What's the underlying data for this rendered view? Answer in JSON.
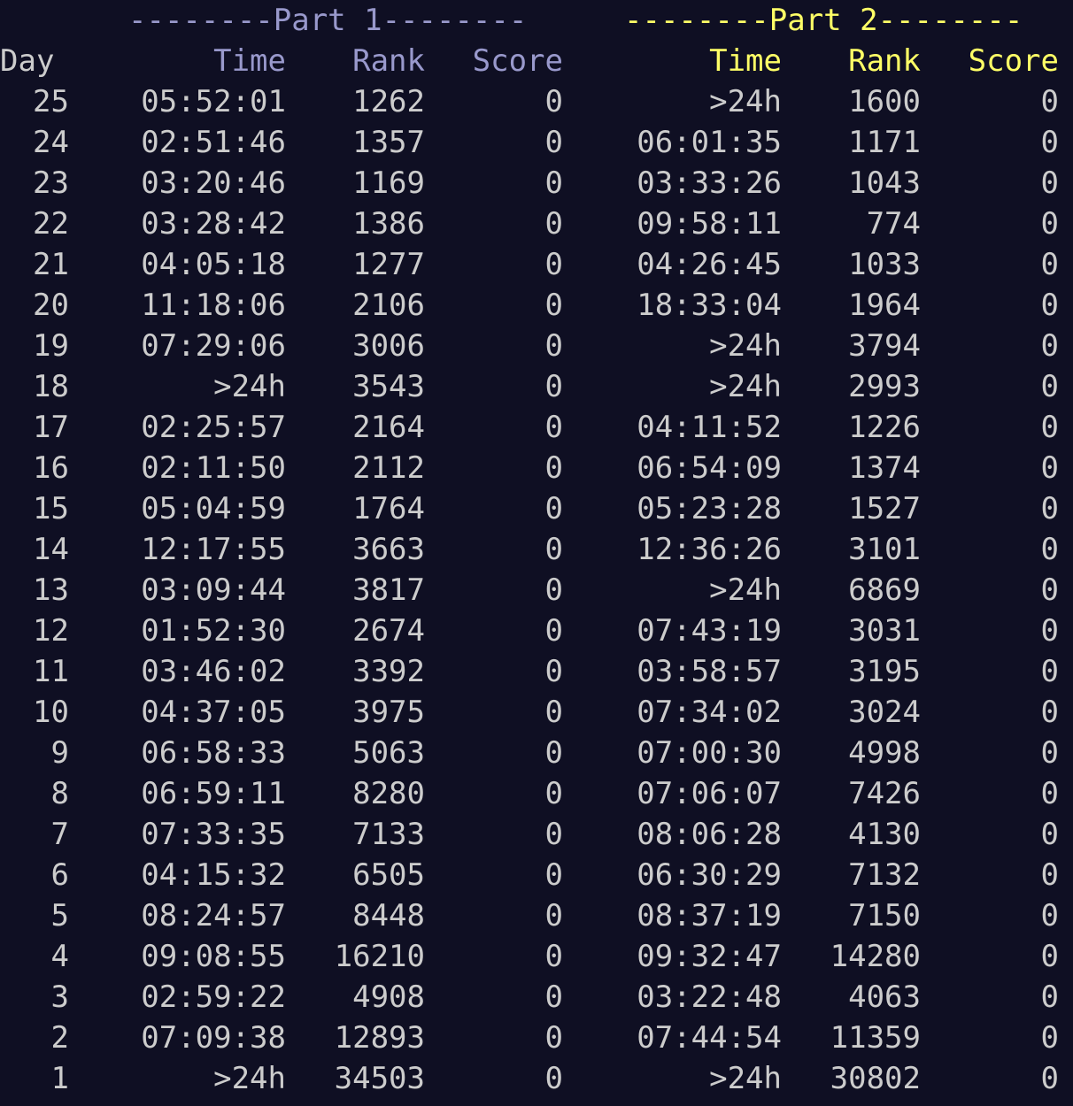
{
  "colors": {
    "background": "#0f0f23",
    "text": "#cccccc",
    "part1": "#9999cc",
    "part2": "#ffff66"
  },
  "banner": {
    "part1": "--------Part 1--------",
    "part2": "--------Part 2--------"
  },
  "headers": {
    "day": "Day",
    "part1": {
      "time": "Time",
      "rank": "Rank",
      "score": "Score"
    },
    "part2": {
      "time": "Time",
      "rank": "Rank",
      "score": "Score"
    }
  },
  "rows": [
    {
      "day": "25",
      "t1": "05:52:01",
      "r1": "1262",
      "s1": "0",
      "t2": ">24h",
      "r2": "1600",
      "s2": "0"
    },
    {
      "day": "24",
      "t1": "02:51:46",
      "r1": "1357",
      "s1": "0",
      "t2": "06:01:35",
      "r2": "1171",
      "s2": "0"
    },
    {
      "day": "23",
      "t1": "03:20:46",
      "r1": "1169",
      "s1": "0",
      "t2": "03:33:26",
      "r2": "1043",
      "s2": "0"
    },
    {
      "day": "22",
      "t1": "03:28:42",
      "r1": "1386",
      "s1": "0",
      "t2": "09:58:11",
      "r2": "774",
      "s2": "0"
    },
    {
      "day": "21",
      "t1": "04:05:18",
      "r1": "1277",
      "s1": "0",
      "t2": "04:26:45",
      "r2": "1033",
      "s2": "0"
    },
    {
      "day": "20",
      "t1": "11:18:06",
      "r1": "2106",
      "s1": "0",
      "t2": "18:33:04",
      "r2": "1964",
      "s2": "0"
    },
    {
      "day": "19",
      "t1": "07:29:06",
      "r1": "3006",
      "s1": "0",
      "t2": ">24h",
      "r2": "3794",
      "s2": "0"
    },
    {
      "day": "18",
      "t1": ">24h",
      "r1": "3543",
      "s1": "0",
      "t2": ">24h",
      "r2": "2993",
      "s2": "0"
    },
    {
      "day": "17",
      "t1": "02:25:57",
      "r1": "2164",
      "s1": "0",
      "t2": "04:11:52",
      "r2": "1226",
      "s2": "0"
    },
    {
      "day": "16",
      "t1": "02:11:50",
      "r1": "2112",
      "s1": "0",
      "t2": "06:54:09",
      "r2": "1374",
      "s2": "0"
    },
    {
      "day": "15",
      "t1": "05:04:59",
      "r1": "1764",
      "s1": "0",
      "t2": "05:23:28",
      "r2": "1527",
      "s2": "0"
    },
    {
      "day": "14",
      "t1": "12:17:55",
      "r1": "3663",
      "s1": "0",
      "t2": "12:36:26",
      "r2": "3101",
      "s2": "0"
    },
    {
      "day": "13",
      "t1": "03:09:44",
      "r1": "3817",
      "s1": "0",
      "t2": ">24h",
      "r2": "6869",
      "s2": "0"
    },
    {
      "day": "12",
      "t1": "01:52:30",
      "r1": "2674",
      "s1": "0",
      "t2": "07:43:19",
      "r2": "3031",
      "s2": "0"
    },
    {
      "day": "11",
      "t1": "03:46:02",
      "r1": "3392",
      "s1": "0",
      "t2": "03:58:57",
      "r2": "3195",
      "s2": "0"
    },
    {
      "day": "10",
      "t1": "04:37:05",
      "r1": "3975",
      "s1": "0",
      "t2": "07:34:02",
      "r2": "3024",
      "s2": "0"
    },
    {
      "day": "9",
      "t1": "06:58:33",
      "r1": "5063",
      "s1": "0",
      "t2": "07:00:30",
      "r2": "4998",
      "s2": "0"
    },
    {
      "day": "8",
      "t1": "06:59:11",
      "r1": "8280",
      "s1": "0",
      "t2": "07:06:07",
      "r2": "7426",
      "s2": "0"
    },
    {
      "day": "7",
      "t1": "07:33:35",
      "r1": "7133",
      "s1": "0",
      "t2": "08:06:28",
      "r2": "4130",
      "s2": "0"
    },
    {
      "day": "6",
      "t1": "04:15:32",
      "r1": "6505",
      "s1": "0",
      "t2": "06:30:29",
      "r2": "7132",
      "s2": "0"
    },
    {
      "day": "5",
      "t1": "08:24:57",
      "r1": "8448",
      "s1": "0",
      "t2": "08:37:19",
      "r2": "7150",
      "s2": "0"
    },
    {
      "day": "4",
      "t1": "09:08:55",
      "r1": "16210",
      "s1": "0",
      "t2": "09:32:47",
      "r2": "14280",
      "s2": "0"
    },
    {
      "day": "3",
      "t1": "02:59:22",
      "r1": "4908",
      "s1": "0",
      "t2": "03:22:48",
      "r2": "4063",
      "s2": "0"
    },
    {
      "day": "2",
      "t1": "07:09:38",
      "r1": "12893",
      "s1": "0",
      "t2": "07:44:54",
      "r2": "11359",
      "s2": "0"
    },
    {
      "day": "1",
      "t1": ">24h",
      "r1": "34503",
      "s1": "0",
      "t2": ">24h",
      "r2": "30802",
      "s2": "0"
    }
  ]
}
